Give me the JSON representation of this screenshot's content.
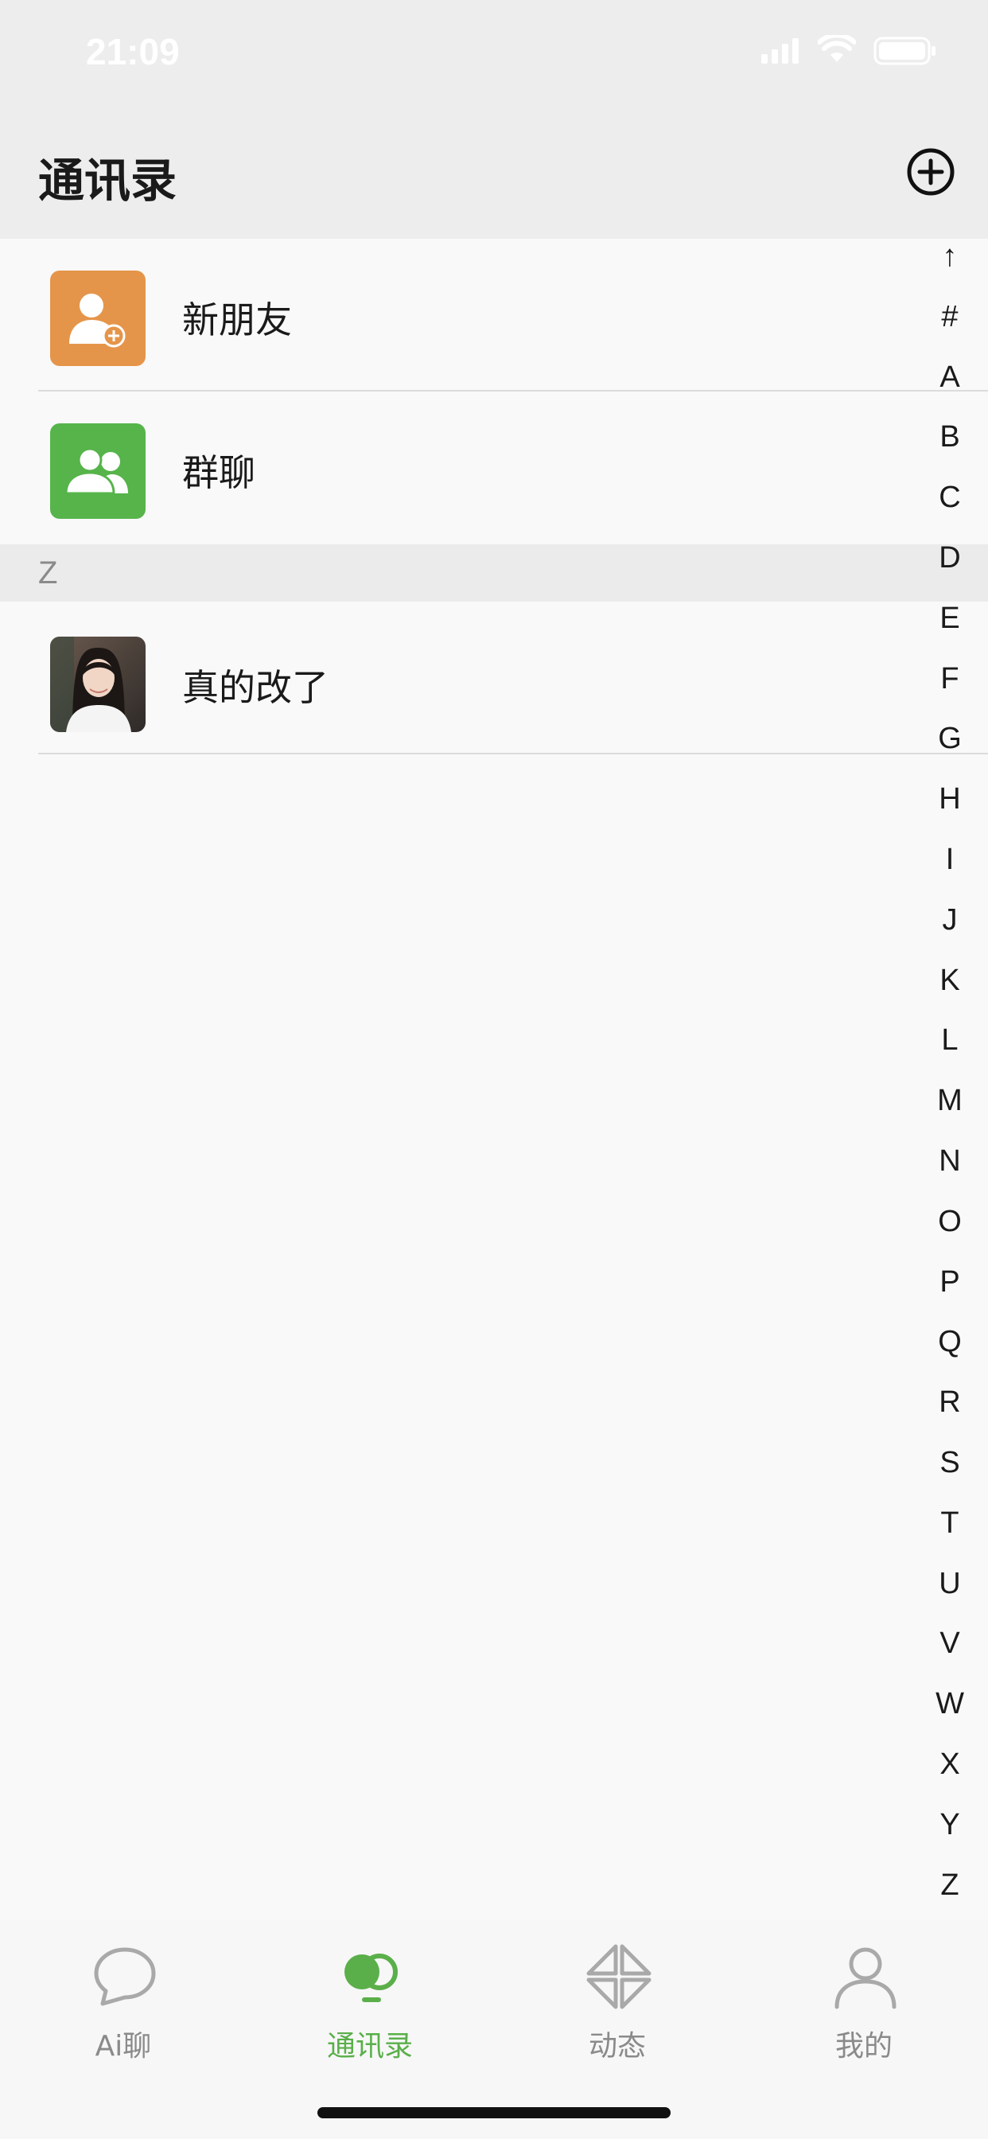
{
  "status_bar": {
    "time": "21:09"
  },
  "header": {
    "title": "通讯录",
    "add_icon": "plus-circle-icon"
  },
  "top_items": [
    {
      "label": "新朋友",
      "icon": "add-friend-icon",
      "color": "#e5954a"
    },
    {
      "label": "群聊",
      "icon": "group-chat-icon",
      "color": "#56b44a"
    }
  ],
  "sections": [
    {
      "letter": "Z",
      "contacts": [
        {
          "name": "真的改了",
          "avatar": "avatar-photo"
        }
      ]
    }
  ],
  "index_bar": [
    "↑",
    "#",
    "A",
    "B",
    "C",
    "D",
    "E",
    "F",
    "G",
    "H",
    "I",
    "J",
    "K",
    "L",
    "M",
    "N",
    "O",
    "P",
    "Q",
    "R",
    "S",
    "T",
    "U",
    "V",
    "W",
    "X",
    "Y",
    "Z"
  ],
  "tabs": [
    {
      "label": "Ai聊",
      "icon": "chat-bubble-icon",
      "active": false
    },
    {
      "label": "通讯录",
      "icon": "contacts-icon",
      "active": true
    },
    {
      "label": "动态",
      "icon": "moments-icon",
      "active": false
    },
    {
      "label": "我的",
      "icon": "profile-icon",
      "active": false
    }
  ],
  "colors": {
    "accent": "#5aaf4a",
    "header_bg": "#ededed",
    "page_bg": "#f9f9f9"
  }
}
